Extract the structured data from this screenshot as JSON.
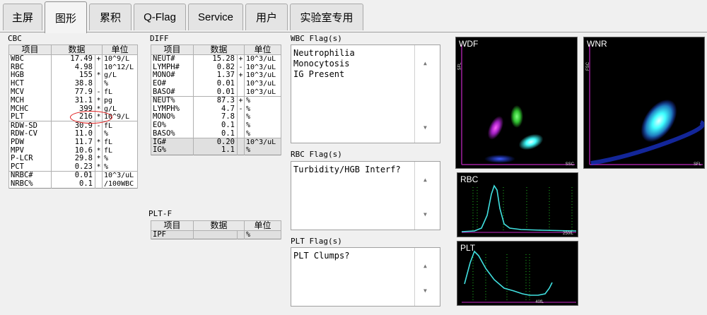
{
  "tabs": [
    "主屏",
    "图形",
    "累积",
    "Q-Flag",
    "Service",
    "用户",
    "实验室专用"
  ],
  "cbc": {
    "title": "CBC",
    "headers": [
      "项目",
      "数据",
      "单位"
    ],
    "rows": [
      [
        "WBC",
        "17.49",
        "+",
        "10^9/L"
      ],
      [
        "RBC",
        "4.98",
        "",
        "10^12/L"
      ],
      [
        "HGB",
        "155",
        "*",
        "g/L"
      ],
      [
        "HCT",
        "38.8",
        "",
        "%"
      ],
      [
        "MCV",
        "77.9",
        "-",
        "fL"
      ],
      [
        "MCH",
        "31.1",
        "*",
        "pg"
      ],
      [
        "MCHC",
        "399",
        "*",
        "g/L"
      ],
      [
        "PLT",
        "216",
        "*",
        "10^9/L"
      ],
      [
        "RDW-SD",
        "30.9",
        "-",
        "fL"
      ],
      [
        "RDW-CV",
        "11.0",
        "",
        "%"
      ],
      [
        "PDW",
        "11.7",
        "*",
        "fL"
      ],
      [
        "MPV",
        "10.6",
        "*",
        "fL"
      ],
      [
        "P-LCR",
        "29.8",
        "*",
        "%"
      ],
      [
        "PCT",
        "0.23",
        "*",
        "%"
      ],
      [
        "NRBC#",
        "0.01",
        "",
        "10^3/uL"
      ],
      [
        "NRBC%",
        "0.1",
        "",
        "/100WBC"
      ]
    ]
  },
  "diff": {
    "title": "DIFF",
    "headers": [
      "项目",
      "数据",
      "单位"
    ],
    "rows": [
      [
        "NEUT#",
        "15.28",
        "+",
        "10^3/uL"
      ],
      [
        "LYMPH#",
        "0.82",
        "-",
        "10^3/uL"
      ],
      [
        "MONO#",
        "1.37",
        "+",
        "10^3/uL"
      ],
      [
        "EO#",
        "0.01",
        "",
        "10^3/uL"
      ],
      [
        "BASO#",
        "0.01",
        "",
        "10^3/uL"
      ],
      [
        "NEUT%",
        "87.3",
        "+",
        "%"
      ],
      [
        "LYMPH%",
        "4.7",
        "-",
        "%"
      ],
      [
        "MONO%",
        "7.8",
        "",
        "%"
      ],
      [
        "EO%",
        "0.1",
        "",
        "%"
      ],
      [
        "BASO%",
        "0.1",
        "",
        "%"
      ],
      [
        "IG#",
        "0.20",
        "",
        "10^3/uL"
      ],
      [
        "IG%",
        "1.1",
        "",
        "%"
      ]
    ]
  },
  "pltf": {
    "title": "PLT-F",
    "headers": [
      "项目",
      "数据",
      "单位"
    ],
    "rows": [
      [
        "IPF",
        "",
        "",
        "%"
      ]
    ]
  },
  "wbc_flag": {
    "title": "WBC Flag(s)",
    "items": [
      "Neutrophilia",
      "Monocytosis",
      "IG Present"
    ]
  },
  "rbc_flag": {
    "title": "RBC Flag(s)",
    "items": [
      "Turbidity/HGB Interf?"
    ]
  },
  "plt_flag": {
    "title": "PLT Flag(s)",
    "items": [
      "PLT Clumps?"
    ]
  },
  "plots": {
    "wdf": {
      "label": "WDF",
      "y_axis": "SFL",
      "x_axis": "SSC"
    },
    "wnr": {
      "label": "WNR",
      "y_axis": "FSC",
      "x_axis": "SFL"
    },
    "rbc": {
      "label": "RBC",
      "x_max": "250fL"
    },
    "plt": {
      "label": "PLT",
      "x_max": "40fL"
    }
  },
  "colors": {
    "histogram_line": "#40e0e0",
    "marker_dotted": "#20c020",
    "neut_cluster": "#40ffff",
    "lymph_cluster": "#d020d0",
    "mono_cluster": "#30c030",
    "debris": "#2040ff"
  }
}
